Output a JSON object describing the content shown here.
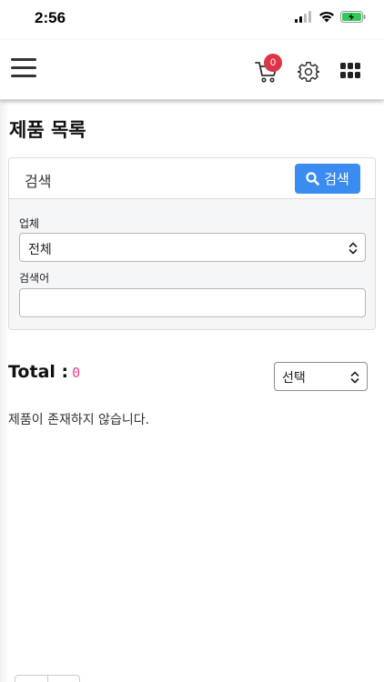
{
  "status_bar": {
    "time": "2:56"
  },
  "header": {
    "cart_count": "0"
  },
  "page": {
    "title": "제품 목록"
  },
  "search": {
    "title": "검색",
    "button_label": "검색",
    "vendor_label": "업체",
    "vendor_value": "전체",
    "keyword_label": "검색어",
    "keyword_value": ""
  },
  "results": {
    "total_label": "Total :",
    "total_count": "0",
    "sort_value": "선택",
    "empty_message": "제품이 존재하지 않습니다."
  },
  "colors": {
    "primary": "#3b8cf0",
    "badge": "#dc3545",
    "count": "#e83e8c"
  }
}
